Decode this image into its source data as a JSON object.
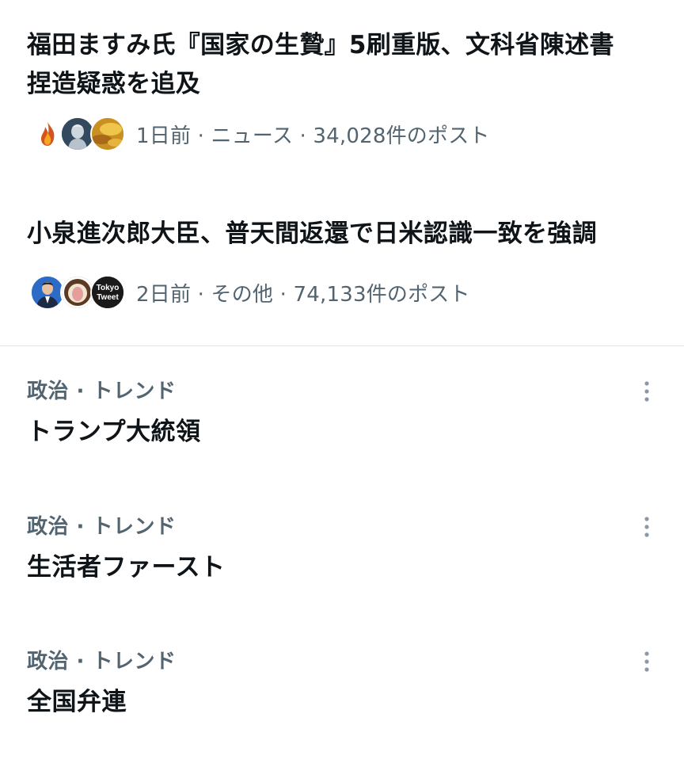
{
  "news": [
    {
      "title_line1": "福田ますみ氏『国家の生贄』5刷重版、文科省陳述書",
      "title_line2": "捏造疑惑を追及",
      "meta": "1日前 · ニュース · 34,028件のポスト",
      "avatars": [
        "flame-avatar",
        "statue-avatar",
        "golden-sky-avatar"
      ]
    },
    {
      "title_line1": "小泉進次郎大臣、普天間返還で日米認識一致を強調",
      "meta": "2日前 · その他 · 74,133件のポスト",
      "avatars": [
        "politician-avatar",
        "food-avatar",
        "tokyo-tweet-avatar"
      ],
      "tokyo_tweet_label_1": "Tokyo",
      "tokyo_tweet_label_2": "Tweet"
    }
  ],
  "trends": [
    {
      "category": "政治 · トレンド",
      "name": "トランプ大統領"
    },
    {
      "category": "政治 · トレンド",
      "name": "生活者ファースト"
    },
    {
      "category": "政治 · トレンド",
      "name": "全国弁連"
    }
  ],
  "colors": {
    "text_primary": "#0f1419",
    "text_secondary": "#536471",
    "divider": "#e1e6ea"
  }
}
